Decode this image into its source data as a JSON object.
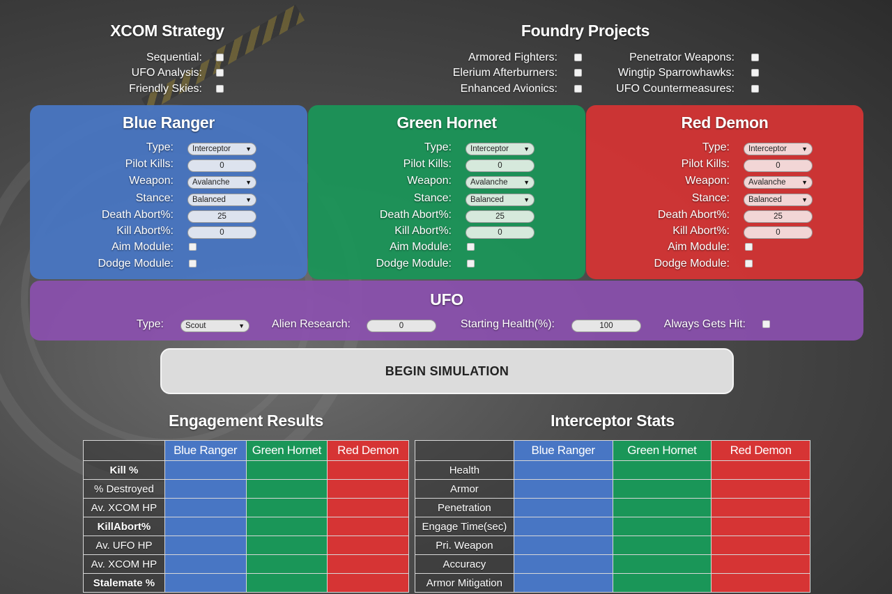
{
  "strategy": {
    "title": "XCOM Strategy",
    "options": [
      {
        "label": "Sequential:",
        "checked": false
      },
      {
        "label": "UFO Analysis:",
        "checked": false
      },
      {
        "label": "Friendly Skies:",
        "checked": false
      }
    ]
  },
  "foundry": {
    "title": "Foundry Projects",
    "left": [
      {
        "label": "Armored Fighters:",
        "checked": false
      },
      {
        "label": "Elerium Afterburners:",
        "checked": false
      },
      {
        "label": "Enhanced Avionics:",
        "checked": false
      }
    ],
    "right": [
      {
        "label": "Penetrator Weapons:",
        "checked": false
      },
      {
        "label": "Wingtip Sparrowhawks:",
        "checked": false
      },
      {
        "label": "UFO Countermeasures:",
        "checked": false
      }
    ]
  },
  "field_labels": {
    "type": "Type:",
    "pilot_kills": "Pilot Kills:",
    "weapon": "Weapon:",
    "stance": "Stance:",
    "death_abort": "Death Abort%:",
    "kill_abort": "Kill Abort%:",
    "aim_module": "Aim Module:",
    "dodge_module": "Dodge Module:"
  },
  "interceptors": [
    {
      "name": "Blue Ranger",
      "color": "#4876c4",
      "type": "Interceptor",
      "pilot_kills": "0",
      "weapon": "Avalanche",
      "stance": "Balanced",
      "death_abort": "25",
      "kill_abort": "0"
    },
    {
      "name": "Green Hornet",
      "color": "#1a9658",
      "type": "Interceptor",
      "pilot_kills": "0",
      "weapon": "Avalanche",
      "stance": "Balanced",
      "death_abort": "25",
      "kill_abort": "0"
    },
    {
      "name": "Red Demon",
      "color": "#d63434",
      "type": "Interceptor",
      "pilot_kills": "0",
      "weapon": "Avalanche",
      "stance": "Balanced",
      "death_abort": "25",
      "kill_abort": "0"
    }
  ],
  "ufo": {
    "title": "UFO",
    "color": "#8c50b0",
    "type_label": "Type:",
    "type_value": "Scout",
    "research_label": "Alien Research:",
    "research_value": "0",
    "health_label": "Starting Health(%):",
    "health_value": "100",
    "always_hit_label": "Always Gets Hit:",
    "always_hit": false
  },
  "begin_button": "BEGIN SIMULATION",
  "engagement": {
    "title": "Engagement Results",
    "columns": [
      "Blue Ranger",
      "Green Hornet",
      "Red Demon"
    ],
    "rows": [
      "Kill %",
      "% Destroyed",
      "Av. XCOM HP",
      "KillAbort%",
      "Av. UFO HP",
      "Av. XCOM HP",
      "Stalemate %"
    ]
  },
  "stats": {
    "title": "Interceptor Stats",
    "columns": [
      "Blue Ranger",
      "Green Hornet",
      "Red Demon"
    ],
    "rows": [
      "Health",
      "Armor",
      "Penetration",
      "Engage Time(sec)",
      "Pri. Weapon",
      "Accuracy",
      "Armor Mitigation"
    ]
  }
}
